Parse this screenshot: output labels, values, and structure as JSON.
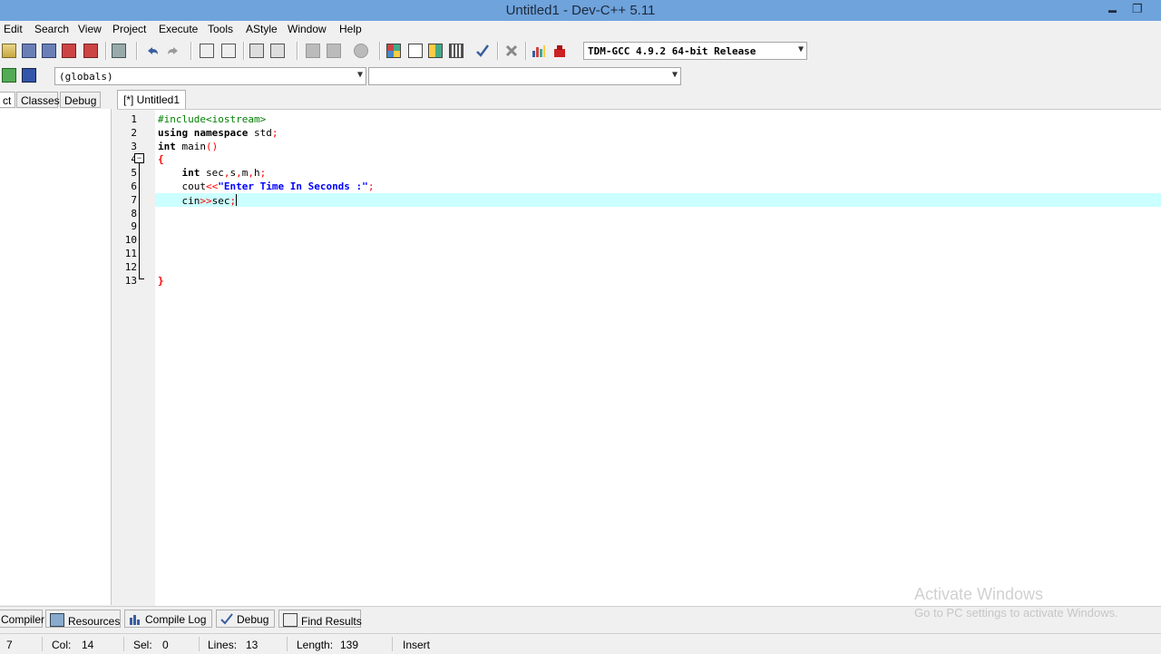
{
  "window": {
    "title": "Untitled1 - Dev-C++ 5.11",
    "minimize": "▬",
    "restore": "❐"
  },
  "menu": [
    "Edit",
    "Search",
    "View",
    "Project",
    "Execute",
    "Tools",
    "AStyle",
    "Window",
    "Help"
  ],
  "toolbar": {
    "compiler_select": "TDM-GCC 4.9.2 64-bit Release",
    "scope_select": "(globals)",
    "function_select": ""
  },
  "left_panel": {
    "tabs": [
      "ct",
      "Classes",
      "Debug"
    ]
  },
  "editor": {
    "tab_label": "[*] Untitled1",
    "current_line": 7,
    "lines": [
      {
        "n": "1",
        "segments": [
          {
            "t": "#include<iostream>",
            "c": "pp"
          }
        ]
      },
      {
        "n": "2",
        "segments": [
          {
            "t": "using",
            "c": "kw"
          },
          {
            "t": " "
          },
          {
            "t": "namespace",
            "c": "kw"
          },
          {
            "t": " std"
          },
          {
            "t": ";",
            "c": "op"
          }
        ]
      },
      {
        "n": "3",
        "segments": [
          {
            "t": "int",
            "c": "kw"
          },
          {
            "t": " main"
          },
          {
            "t": "()",
            "c": "op"
          }
        ]
      },
      {
        "n": "4",
        "segments": [
          {
            "t": "{",
            "c": "sym"
          }
        ]
      },
      {
        "n": "5",
        "segments": [
          {
            "t": "    "
          },
          {
            "t": "int",
            "c": "kw"
          },
          {
            "t": " sec"
          },
          {
            "t": ",",
            "c": "op"
          },
          {
            "t": "s"
          },
          {
            "t": ",",
            "c": "op"
          },
          {
            "t": "m"
          },
          {
            "t": ",",
            "c": "op"
          },
          {
            "t": "h"
          },
          {
            "t": ";",
            "c": "op"
          }
        ]
      },
      {
        "n": "6",
        "segments": [
          {
            "t": "    cout"
          },
          {
            "t": "<<",
            "c": "op"
          },
          {
            "t": "\"Enter Time In Seconds :\"",
            "c": "str"
          },
          {
            "t": ";",
            "c": "op"
          }
        ]
      },
      {
        "n": "7",
        "segments": [
          {
            "t": "    cin"
          },
          {
            "t": ">>",
            "c": "op"
          },
          {
            "t": "sec"
          },
          {
            "t": ";",
            "c": "op"
          }
        ]
      },
      {
        "n": "8",
        "segments": []
      },
      {
        "n": "9",
        "segments": []
      },
      {
        "n": "10",
        "segments": []
      },
      {
        "n": "11",
        "segments": []
      },
      {
        "n": "12",
        "segments": []
      },
      {
        "n": "13",
        "segments": [
          {
            "t": "}",
            "c": "sym"
          }
        ]
      }
    ]
  },
  "bottom_tabs": [
    "Compiler",
    "Resources",
    "Compile Log",
    "Debug",
    "Find Results"
  ],
  "status": {
    "line_value": "7",
    "col_label": "Col:",
    "col_value": "14",
    "sel_label": "Sel:",
    "sel_value": "0",
    "lines_label": "Lines:",
    "lines_value": "13",
    "length_label": "Length:",
    "length_value": "139",
    "mode": "Insert"
  },
  "watermark": {
    "line1": "Activate Windows",
    "line2": "Go to PC settings to activate Windows."
  },
  "colors": {
    "titlebar": "#6fa3dc",
    "current_line": "#ccffff",
    "keyword": "#000000",
    "string": "#0000ff",
    "preprocessor": "#008000",
    "operator": "#ff0000"
  }
}
